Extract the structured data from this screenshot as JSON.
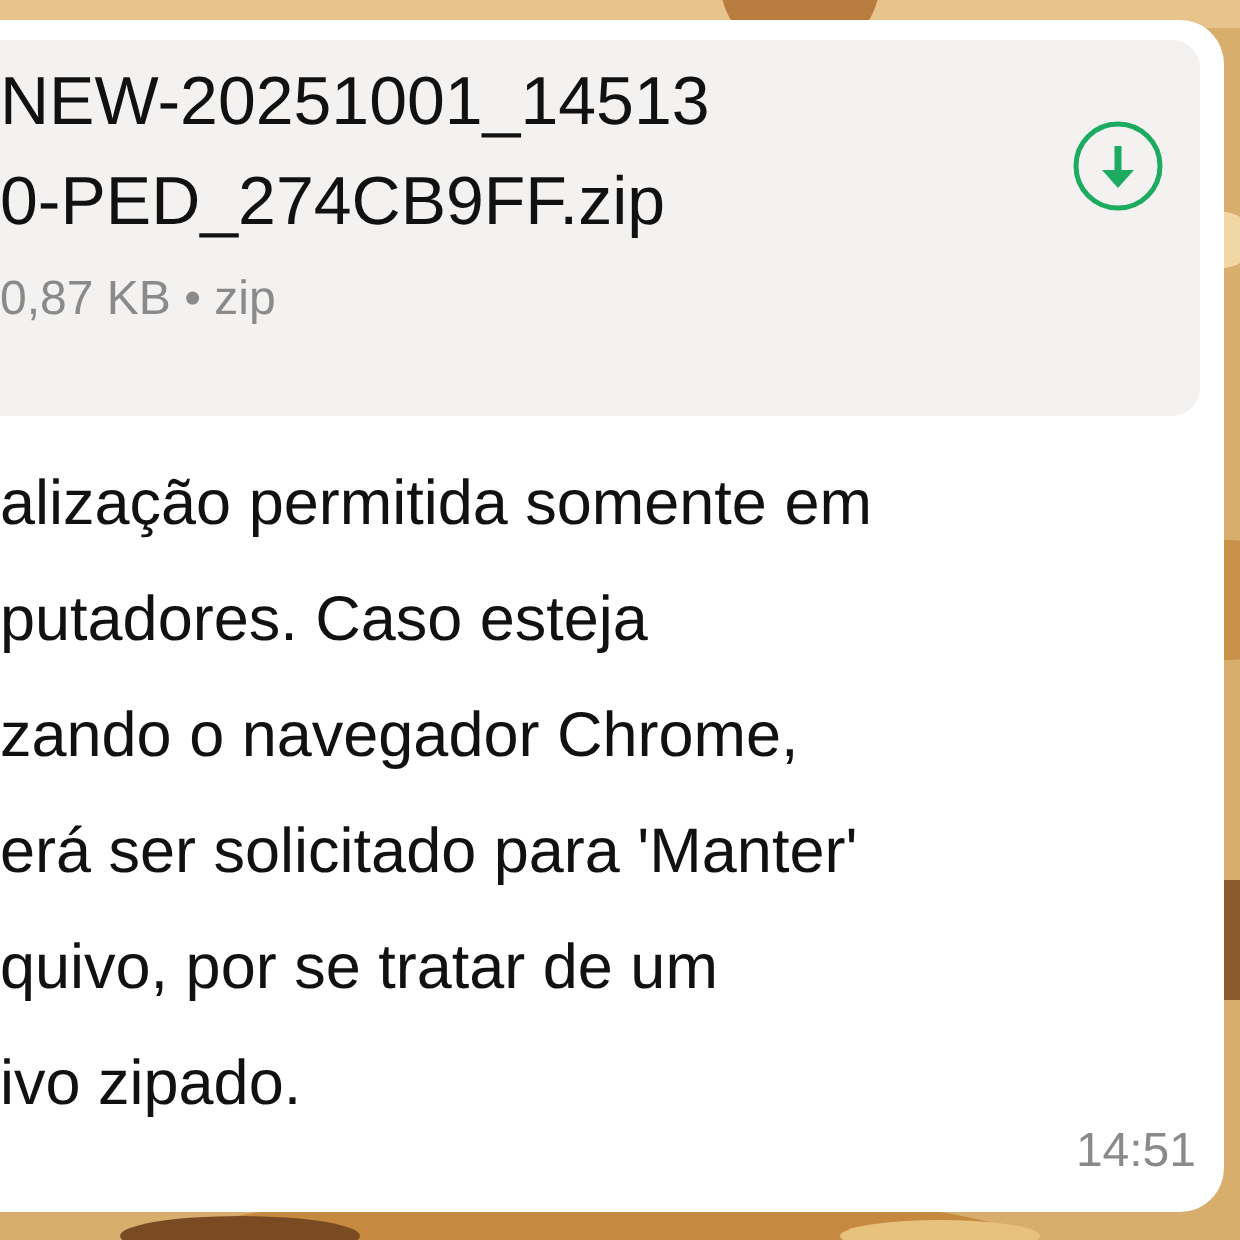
{
  "message": {
    "file": {
      "name_lines": [
        "NEW-20251001_14513",
        "0-PED_274CB9FF.zip"
      ],
      "meta": "0,87 KB • zip"
    },
    "text_lines": [
      "alização permitida somente em",
      "putadores. Caso esteja",
      "zando o navegador Chrome,",
      "erá ser solicitado para 'Manter'",
      "quivo, por se tratar de um",
      "ivo zipado."
    ],
    "time": "14:51"
  }
}
